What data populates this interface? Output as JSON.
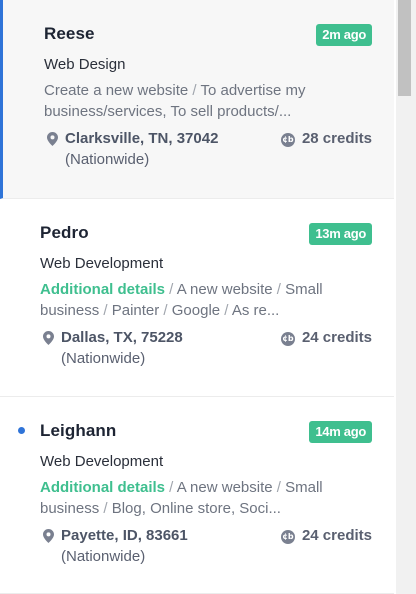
{
  "leads": [
    {
      "name": "Reese",
      "time": "2m ago",
      "service": "Web Design",
      "details_prefix": "",
      "details_items": [
        "Create a new website",
        "To advertise my business/services, To sell products/..."
      ],
      "location": "Clarksville, TN, 37042",
      "scope": "(Nationwide)",
      "credits": "28 credits",
      "unread": false,
      "selected": true
    },
    {
      "name": "Pedro",
      "time": "13m ago",
      "service": "Web Development",
      "details_prefix": "Additional details",
      "details_items": [
        "A new website",
        "Small business",
        "Painter",
        "Google",
        "As re..."
      ],
      "location": "Dallas, TX, 75228",
      "scope": "(Nationwide)",
      "credits": "24 credits",
      "unread": false,
      "selected": false
    },
    {
      "name": "Leighann",
      "time": "14m ago",
      "service": "Web Development",
      "details_prefix": "Additional details",
      "details_items": [
        "A new website",
        "Small business",
        "Blog, Online store, Soci..."
      ],
      "location": "Payette, ID, 83661",
      "scope": "(Nationwide)",
      "credits": "24 credits",
      "unread": true,
      "selected": false
    }
  ],
  "icons": {
    "location": "map-pin-icon",
    "credits": "credits-coin-icon"
  },
  "colors": {
    "accent_green": "#3fbf8f",
    "selected_bar": "#2f74d8",
    "unread_dot": "#2f74d8"
  }
}
